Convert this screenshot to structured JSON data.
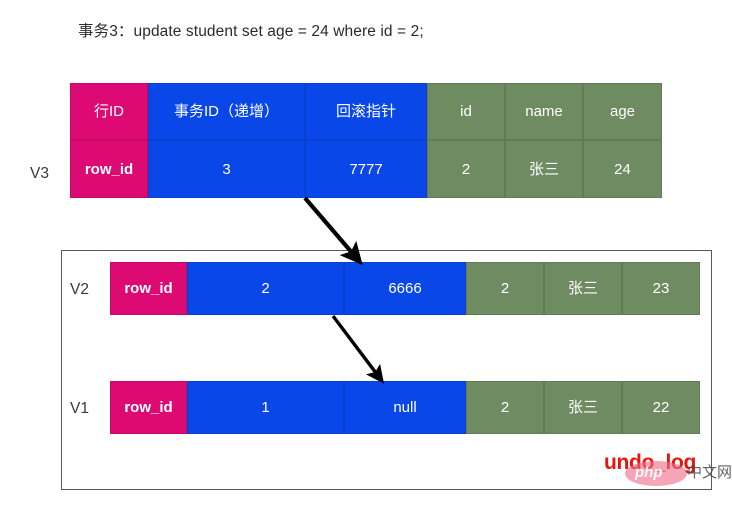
{
  "title": "事务3：update student set age = 24 where id = 2;",
  "colors": {
    "row_id_pink": "#dd0a73",
    "trx_blue": "#0a47e8",
    "data_green": "#6f8b61",
    "undo_log_red": "#e8140f",
    "box_border": "#5a5a5a",
    "arrow": "#000000"
  },
  "table": {
    "headers": [
      {
        "label": "行ID",
        "color": "pink"
      },
      {
        "label": "事务ID（递增）",
        "color": "blue"
      },
      {
        "label": "回滚指针",
        "color": "blue"
      },
      {
        "label": "id",
        "color": "green"
      },
      {
        "label": "name",
        "color": "green"
      },
      {
        "label": "age",
        "color": "green"
      }
    ],
    "versions": [
      {
        "version_label": "V3",
        "location": "current-row",
        "cells": [
          {
            "value": "row_id",
            "color": "pink"
          },
          {
            "value": "3",
            "color": "blue"
          },
          {
            "value": "7777",
            "color": "blue"
          },
          {
            "value": "2",
            "color": "green"
          },
          {
            "value": "张三",
            "color": "green"
          },
          {
            "value": "24",
            "color": "green"
          }
        ]
      },
      {
        "version_label": "V2",
        "location": "undo-log",
        "cells": [
          {
            "value": "row_id",
            "color": "pink"
          },
          {
            "value": "2",
            "color": "blue"
          },
          {
            "value": "6666",
            "color": "blue"
          },
          {
            "value": "2",
            "color": "green"
          },
          {
            "value": "张三",
            "color": "green"
          },
          {
            "value": "23",
            "color": "green"
          }
        ]
      },
      {
        "version_label": "V1",
        "location": "undo-log",
        "cells": [
          {
            "value": "row_id",
            "color": "pink"
          },
          {
            "value": "1",
            "color": "blue"
          },
          {
            "value": "null",
            "color": "blue"
          },
          {
            "value": "2",
            "color": "green"
          },
          {
            "value": "张三",
            "color": "green"
          },
          {
            "value": "22",
            "color": "green"
          }
        ]
      }
    ]
  },
  "arrows": [
    {
      "name": "v3-to-v2-rollback-pointer",
      "from": "V3",
      "to": "V2"
    },
    {
      "name": "v2-to-v1-rollback-pointer",
      "from": "V2",
      "to": "V1"
    }
  ],
  "undo_log_caption": "undo_log",
  "watermark": {
    "logo_text": "php",
    "site_text": "中文网"
  }
}
